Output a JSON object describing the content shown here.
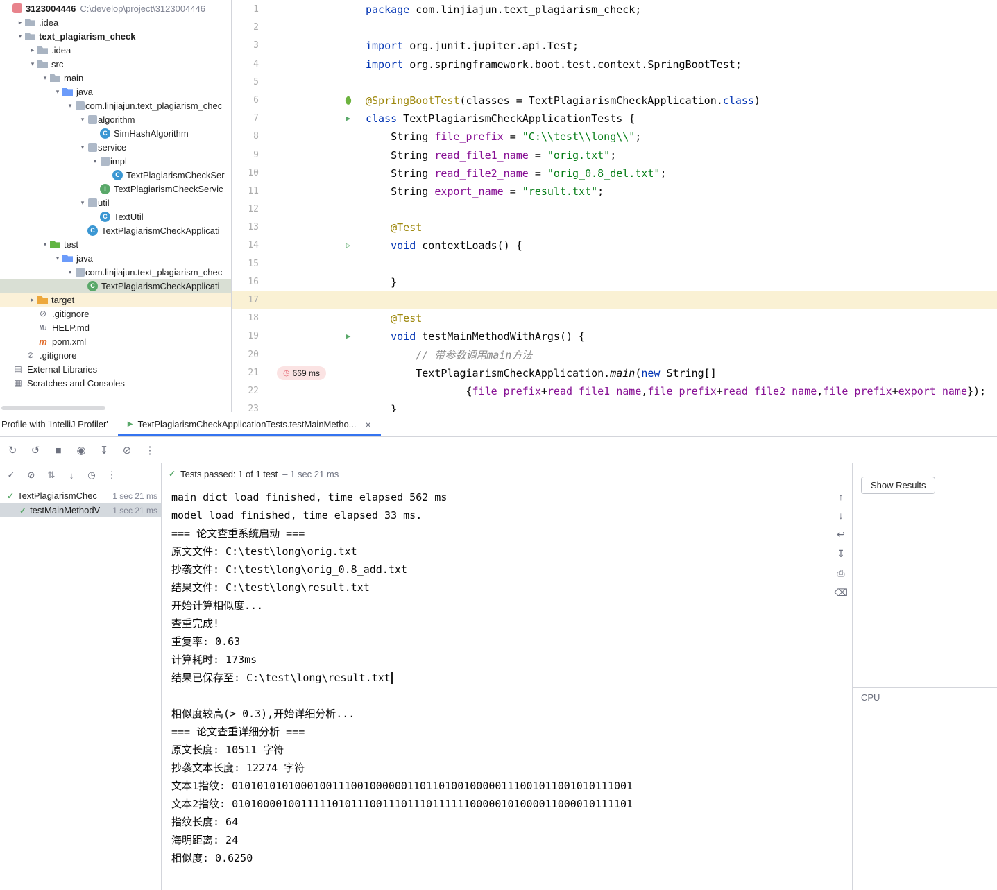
{
  "icon_glyphs": {
    "chevron_down": "▾",
    "chevron_right": "▸",
    "run": "▷",
    "run_test": "▶",
    "check": "✓",
    "clock": "◷",
    "tab_run": "▶",
    "close": "×"
  },
  "tree_icon_glyphs": {
    "class": "C",
    "class-test": "C",
    "interface": "I",
    "ignore": "⊘",
    "markdown": "M↓",
    "maven": "m",
    "libraries": "▤",
    "scratches": "▦"
  },
  "project_tree": {
    "rows": [
      {
        "indent": 0,
        "chevron": null,
        "icon": "project",
        "label": "3123004446",
        "sublabel": "C:\\develop\\project\\3123004446",
        "bold": true
      },
      {
        "indent": 1,
        "chevron": "right",
        "icon": "folder",
        "label": ".idea"
      },
      {
        "indent": 1,
        "chevron": "down",
        "icon": "folder",
        "label": "text_plagiarism_check",
        "bold": true
      },
      {
        "indent": 2,
        "chevron": "right",
        "icon": "folder",
        "label": ".idea"
      },
      {
        "indent": 2,
        "chevron": "down",
        "icon": "folder",
        "label": "src"
      },
      {
        "indent": 3,
        "chevron": "down",
        "icon": "folder",
        "label": "main"
      },
      {
        "indent": 4,
        "chevron": "down",
        "icon": "folder-source",
        "label": "java"
      },
      {
        "indent": 5,
        "chevron": "down",
        "icon": "package",
        "label": "com.linjiajun.text_plagiarism_chec"
      },
      {
        "indent": 6,
        "chevron": "down",
        "icon": "package",
        "label": "algorithm"
      },
      {
        "indent": 7,
        "chevron": null,
        "icon": "class",
        "label": "SimHashAlgorithm"
      },
      {
        "indent": 6,
        "chevron": "down",
        "icon": "package",
        "label": "service"
      },
      {
        "indent": 7,
        "chevron": "down",
        "icon": "package",
        "label": "impl"
      },
      {
        "indent": 8,
        "chevron": null,
        "icon": "class",
        "label": "TextPlagiarismCheckSer"
      },
      {
        "indent": 7,
        "chevron": null,
        "icon": "interface",
        "label": "TextPlagiarismCheckServic"
      },
      {
        "indent": 6,
        "chevron": "down",
        "icon": "package",
        "label": "util"
      },
      {
        "indent": 7,
        "chevron": null,
        "icon": "class",
        "label": "TextUtil"
      },
      {
        "indent": 6,
        "chevron": null,
        "icon": "class",
        "label": "TextPlagiarismCheckApplicati"
      },
      {
        "indent": 3,
        "chevron": "down",
        "icon": "folder-test",
        "label": "test"
      },
      {
        "indent": 4,
        "chevron": "down",
        "icon": "folder-source",
        "label": "java"
      },
      {
        "indent": 5,
        "chevron": "down",
        "icon": "package",
        "label": "com.linjiajun.text_plagiarism_chec"
      },
      {
        "indent": 6,
        "chevron": null,
        "icon": "class-test",
        "label": "TextPlagiarismCheckApplicati",
        "selected": true
      },
      {
        "indent": 2,
        "chevron": "right",
        "icon": "folder-excluded",
        "label": "target",
        "excluded": true
      },
      {
        "indent": 2,
        "chevron": null,
        "icon": "ignore",
        "label": ".gitignore"
      },
      {
        "indent": 2,
        "chevron": null,
        "icon": "markdown",
        "label": "HELP.md"
      },
      {
        "indent": 2,
        "chevron": null,
        "icon": "maven",
        "label": "pom.xml"
      },
      {
        "indent": 1,
        "chevron": null,
        "icon": "ignore",
        "label": ".gitignore"
      },
      {
        "indent": 0,
        "chevron": null,
        "icon": "libraries",
        "label": "External Libraries"
      },
      {
        "indent": 0,
        "chevron": null,
        "icon": "scratches",
        "label": "Scratches and Consoles"
      }
    ]
  },
  "editor": {
    "highlight_line": 17,
    "gutter_icons": {
      "6": "spring-leaf",
      "7": "run-test",
      "14": "run",
      "19": "run-test"
    },
    "badge": {
      "line": 21,
      "text": "669 ms"
    },
    "lines": [
      {
        "n": 1,
        "t": [
          [
            "k",
            "package"
          ],
          [
            "p",
            " com.linjiajun.text_plagiarism_check;"
          ]
        ]
      },
      {
        "n": 2,
        "t": []
      },
      {
        "n": 3,
        "t": [
          [
            "k",
            "import"
          ],
          [
            "p",
            " org.junit.jupiter.api.Test;"
          ]
        ]
      },
      {
        "n": 4,
        "t": [
          [
            "k",
            "import"
          ],
          [
            "p",
            " org.springframework.boot.test.context.SpringBootTest;"
          ]
        ]
      },
      {
        "n": 5,
        "t": []
      },
      {
        "n": 6,
        "t": [
          [
            "a",
            "@SpringBootTest"
          ],
          [
            "p",
            "(classes = TextPlagiarismCheckApplication."
          ],
          [
            "k",
            "class"
          ],
          [
            "p",
            ")"
          ]
        ]
      },
      {
        "n": 7,
        "t": [
          [
            "k",
            "class"
          ],
          [
            "p",
            " TextPlagiarismCheckApplicationTests {"
          ]
        ]
      },
      {
        "n": 8,
        "t": [
          [
            "p",
            "    String "
          ],
          [
            "f",
            "file_prefix"
          ],
          [
            "p",
            " = "
          ],
          [
            "s",
            "\"C:\\\\test\\\\long\\\\\""
          ],
          [
            "p",
            ";"
          ]
        ]
      },
      {
        "n": 9,
        "t": [
          [
            "p",
            "    String "
          ],
          [
            "f",
            "read_file1_name"
          ],
          [
            "p",
            " = "
          ],
          [
            "s",
            "\"orig.txt\""
          ],
          [
            "p",
            ";"
          ]
        ]
      },
      {
        "n": 10,
        "t": [
          [
            "p",
            "    String "
          ],
          [
            "f",
            "read_file2_name"
          ],
          [
            "p",
            " = "
          ],
          [
            "s",
            "\"orig_0.8_del.txt\""
          ],
          [
            "p",
            ";"
          ]
        ]
      },
      {
        "n": 11,
        "t": [
          [
            "p",
            "    String "
          ],
          [
            "f",
            "export_name"
          ],
          [
            "p",
            " = "
          ],
          [
            "s",
            "\"result.txt\""
          ],
          [
            "p",
            ";"
          ]
        ]
      },
      {
        "n": 12,
        "t": []
      },
      {
        "n": 13,
        "t": [
          [
            "p",
            "    "
          ],
          [
            "a",
            "@Test"
          ]
        ]
      },
      {
        "n": 14,
        "t": [
          [
            "p",
            "    "
          ],
          [
            "k",
            "void"
          ],
          [
            "p",
            " contextLoads() {"
          ]
        ]
      },
      {
        "n": 15,
        "t": []
      },
      {
        "n": 16,
        "t": [
          [
            "p",
            "    }"
          ]
        ]
      },
      {
        "n": 17,
        "t": []
      },
      {
        "n": 18,
        "t": [
          [
            "p",
            "    "
          ],
          [
            "a",
            "@Test"
          ]
        ]
      },
      {
        "n": 19,
        "t": [
          [
            "p",
            "    "
          ],
          [
            "k",
            "void"
          ],
          [
            "p",
            " testMainMethodWithArgs() {"
          ]
        ]
      },
      {
        "n": 20,
        "t": [
          [
            "p",
            "        "
          ],
          [
            "c",
            "// 带参数调用main方法"
          ]
        ]
      },
      {
        "n": 21,
        "t": [
          [
            "p",
            "        TextPlagiarismCheckApplication."
          ],
          [
            "i",
            "main"
          ],
          [
            "p",
            "("
          ],
          [
            "k",
            "new"
          ],
          [
            "p",
            " String[]"
          ]
        ]
      },
      {
        "n": 22,
        "t": [
          [
            "p",
            "                {"
          ],
          [
            "f",
            "file_prefix"
          ],
          [
            "p",
            "+"
          ],
          [
            "f",
            "read_file1_name"
          ],
          [
            "p",
            ","
          ],
          [
            "f",
            "file_prefix"
          ],
          [
            "p",
            "+"
          ],
          [
            "f",
            "read_file2_name"
          ],
          [
            "p",
            ","
          ],
          [
            "f",
            "file_prefix"
          ],
          [
            "p",
            "+"
          ],
          [
            "f",
            "export_name"
          ],
          [
            "p",
            "});"
          ]
        ]
      },
      {
        "n": 23,
        "t": [
          [
            "p",
            "    }"
          ]
        ]
      }
    ]
  },
  "tabs": {
    "profile_tab": "Profile with 'IntelliJ Profiler'",
    "active_tab": "TextPlagiarismCheckApplicationTests.testMainMetho...",
    "close": "×"
  },
  "run_toolbar": [
    {
      "name": "rerun-icon",
      "glyph": "↻"
    },
    {
      "name": "rerun-failed-tests-icon",
      "glyph": "↺"
    },
    {
      "name": "stop-icon",
      "glyph": "■"
    },
    {
      "name": "snapshot-icon",
      "glyph": "◉"
    },
    {
      "name": "import-test-results-icon",
      "glyph": "↧"
    },
    {
      "name": "suspend-icon",
      "glyph": "⊘"
    },
    {
      "name": "more-options-icon",
      "glyph": "⋮"
    }
  ],
  "test_panel": {
    "filter_icons": [
      {
        "name": "show-passed-icon",
        "glyph": "✓"
      },
      {
        "name": "show-ignored-icon",
        "glyph": "⊘"
      },
      {
        "name": "sort-alphabetically-icon",
        "glyph": "⇅"
      },
      {
        "name": "navigate-icon",
        "glyph": "↓"
      },
      {
        "name": "sort-by-duration-icon",
        "glyph": "◷"
      },
      {
        "name": "more-icon",
        "glyph": "⋮"
      }
    ],
    "status_label": "Tests passed: 1 of 1 test",
    "status_detail": "– 1 sec 21 ms",
    "passed_icon": "✓",
    "tests": [
      {
        "name": "TextPlagiarismChec",
        "time": "1 sec 21 ms",
        "indent": 0,
        "selected": false
      },
      {
        "name": "testMainMethodV",
        "time": "1 sec 21 ms",
        "indent": 1,
        "selected": true
      }
    ]
  },
  "console": {
    "caret_line_index": 10,
    "lines": [
      "main dict load finished, time elapsed 562 ms",
      "model load finished, time elapsed 33 ms.",
      "=== 论文查重系统启动 ===",
      "原文文件: C:\\test\\long\\orig.txt",
      "抄袭文件: C:\\test\\long\\orig_0.8_add.txt",
      "结果文件: C:\\test\\long\\result.txt",
      "开始计算相似度...",
      "查重完成!",
      "重复率: 0.63",
      "计算耗时: 173ms",
      "结果已保存至: C:\\test\\long\\result.txt",
      "",
      "相似度较高(> 0.3),开始详细分析...",
      "=== 论文查重详细分析 ===",
      "原文长度: 10511 字符",
      "抄袭文本长度: 12274 字符",
      "文本1指纹: 0101010101000100111001000000110110100100000111001011001010111001",
      "文本2指纹: 0101000010011111010111001110111011111100000101000011000010111101",
      "指纹长度: 64",
      "海明距离: 24",
      "相似度: 0.6250"
    ]
  },
  "right_panel": {
    "show_results": "Show Results",
    "cpu_label": "CPU",
    "icons": [
      {
        "name": "scroll-up-icon",
        "glyph": "↑"
      },
      {
        "name": "scroll-down-icon",
        "glyph": "↓"
      },
      {
        "name": "soft-wrap-icon",
        "glyph": "↩"
      },
      {
        "name": "scroll-to-end-icon",
        "glyph": "↧"
      },
      {
        "name": "print-icon",
        "glyph": "⎙"
      },
      {
        "name": "clear-console-icon",
        "glyph": "⌫"
      }
    ]
  },
  "colors": {
    "accent": "#3574F0",
    "test_green": "#59A869",
    "badge_bg": "#FBE3E3",
    "caret_row": "#FAF1D4",
    "excluded_row": "#FBF1D8"
  }
}
